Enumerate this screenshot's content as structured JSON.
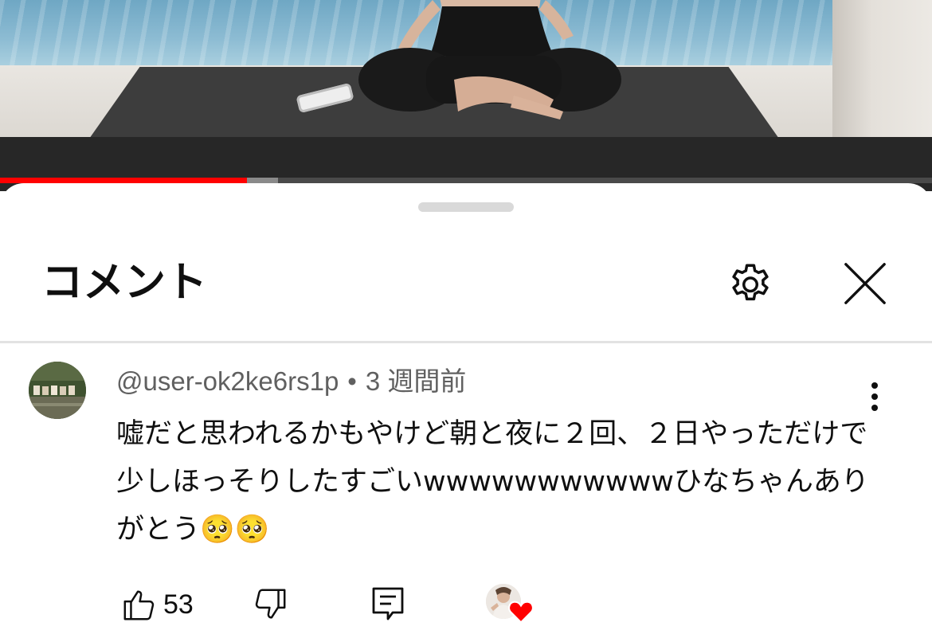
{
  "player": {
    "played_fraction": 0.265,
    "buffered_fraction": 0.298
  },
  "comments_sheet": {
    "title": "コメント",
    "settings_icon": "gear-icon",
    "close_icon": "close-icon"
  },
  "comment": {
    "author": "@user-ok2ke6rs1p",
    "separator": "•",
    "timestamp": "3 週間前",
    "text": "嘘だと思われるかもやけど朝と夜に２回、２日やっただけで少しほっそりしたすごいwwwwwwwwwwwひなちゃんありがとう🥺🥺",
    "likes": "53",
    "creator_heart": true
  },
  "colors": {
    "accent": "#ff0000",
    "text_primary": "#0f0f0f",
    "text_secondary": "#606060"
  }
}
